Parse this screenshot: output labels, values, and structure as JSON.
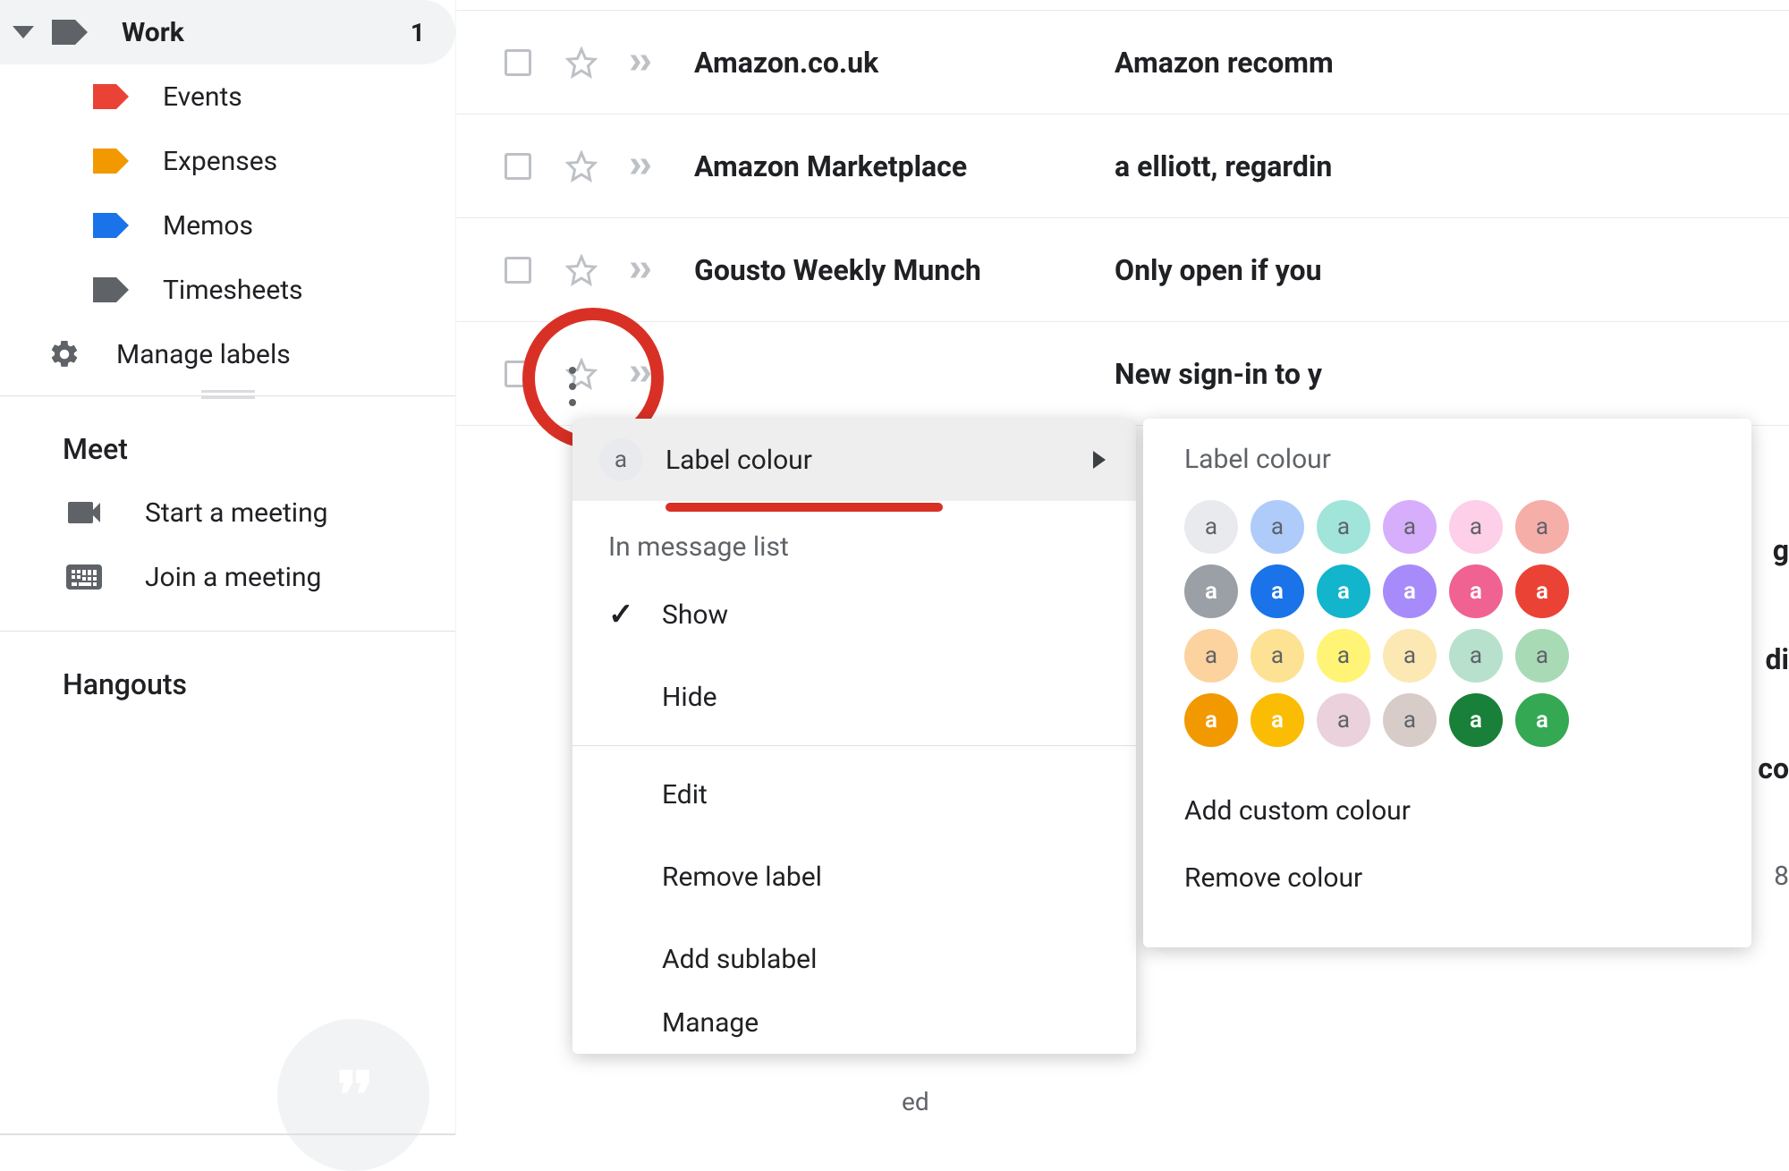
{
  "sidebar": {
    "parent": {
      "label": "Work",
      "color": "#5f6368",
      "count": "1"
    },
    "children": [
      {
        "label": "Events",
        "color": "#ea4335"
      },
      {
        "label": "Expenses",
        "color": "#f29900"
      },
      {
        "label": "Memos",
        "color": "#1a73e8"
      },
      {
        "label": "Timesheets",
        "color": "#5f6368"
      }
    ],
    "manage_labels": "Manage labels"
  },
  "meet": {
    "heading": "Meet",
    "start": "Start a meeting",
    "join": "Join a meeting"
  },
  "hangouts": {
    "heading": "Hangouts"
  },
  "emails": [
    {
      "sender": "Amazon.co.uk",
      "subject": "Amazon recomm"
    },
    {
      "sender": "Amazon Marketplace",
      "subject": "a elliott, regardin"
    },
    {
      "sender": "Gousto Weekly Munch",
      "subject": "Only open if you"
    },
    {
      "sender": "",
      "subject": "New sign-in to y"
    }
  ],
  "menu": {
    "label_colour": "Label colour",
    "swatch_char": "a",
    "in_msg": "In message list",
    "show": "Show",
    "hide": "Hide",
    "edit": "Edit",
    "remove_label": "Remove label",
    "add_sublabel": "Add sublabel",
    "manage": "Manage"
  },
  "submenu": {
    "title": "Label colour",
    "add_custom": "Add custom colour",
    "remove_colour": "Remove colour",
    "swatches": [
      {
        "bg": "#e8eaed",
        "dark": false
      },
      {
        "bg": "#aecbfa",
        "dark": false
      },
      {
        "bg": "#a1e4d9",
        "dark": false
      },
      {
        "bg": "#d7aefb",
        "dark": false
      },
      {
        "bg": "#fdcfe8",
        "dark": false
      },
      {
        "bg": "#f6aea9",
        "dark": false
      },
      {
        "bg": "#9aa0a6",
        "dark": true
      },
      {
        "bg": "#1a73e8",
        "dark": true
      },
      {
        "bg": "#12b5cb",
        "dark": true
      },
      {
        "bg": "#a78bfa",
        "dark": true
      },
      {
        "bg": "#f06292",
        "dark": true
      },
      {
        "bg": "#ea4335",
        "dark": true
      },
      {
        "bg": "#fcd29e",
        "dark": false
      },
      {
        "bg": "#fde293",
        "dark": false
      },
      {
        "bg": "#fff475",
        "dark": false
      },
      {
        "bg": "#fce8b2",
        "dark": false
      },
      {
        "bg": "#b7e1cd",
        "dark": false
      },
      {
        "bg": "#a8dab5",
        "dark": false
      },
      {
        "bg": "#f29900",
        "dark": true
      },
      {
        "bg": "#fbbc04",
        "dark": true
      },
      {
        "bg": "#ead1dc",
        "dark": false
      },
      {
        "bg": "#d7ccc8",
        "dark": false
      },
      {
        "bg": "#188038",
        "dark": true
      },
      {
        "bg": "#34a853",
        "dark": true
      }
    ]
  },
  "partial": {
    "ed": "ed",
    "g": "g",
    "di": "di",
    "co": "co",
    "eight": "8"
  }
}
